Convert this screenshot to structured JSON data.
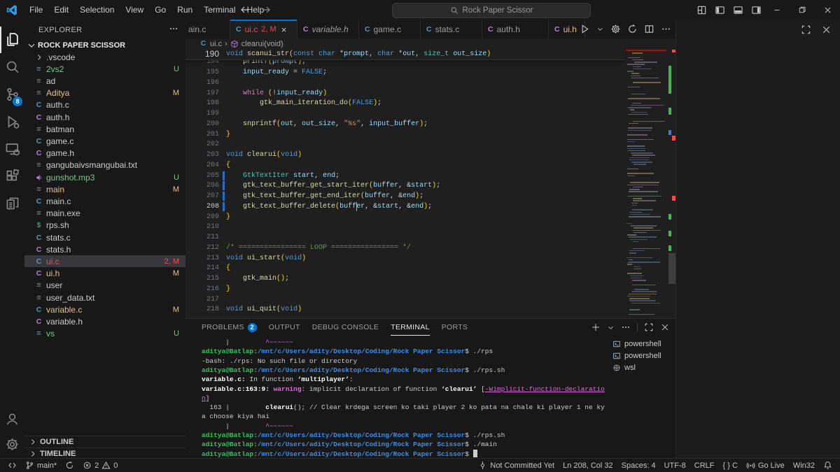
{
  "window": {
    "menus": [
      "File",
      "Edit",
      "Selection",
      "View",
      "Go",
      "Run",
      "Terminal",
      "Help"
    ],
    "search": "Rock Paper Scissor",
    "nav": [
      "back",
      "forward"
    ],
    "layout_controls": [
      "customize-layout",
      "toggle-sidebar-left",
      "toggle-panel-bottom",
      "toggle-sidebar-right"
    ],
    "controls": [
      "minimize",
      "restore",
      "close"
    ]
  },
  "activity_bar": {
    "top": [
      {
        "id": "explorer",
        "active": true
      },
      {
        "id": "search"
      },
      {
        "id": "source-control",
        "badge": "8"
      },
      {
        "id": "run-debug"
      },
      {
        "id": "remote-explorer"
      },
      {
        "id": "extensions"
      },
      {
        "id": "references"
      }
    ],
    "bottom": [
      {
        "id": "account"
      },
      {
        "id": "settings"
      }
    ]
  },
  "explorer": {
    "title": "EXPLORER",
    "root": "ROCK PAPER SCISSOR",
    "files": [
      {
        "name": ".vscode",
        "icon": "folder"
      },
      {
        "name": "2vs2",
        "icon": "file",
        "badge": "U",
        "state": "untracked"
      },
      {
        "name": "ad",
        "icon": "file"
      },
      {
        "name": "Aditya",
        "icon": "file",
        "badge": "M",
        "state": "modified"
      },
      {
        "name": "auth.c",
        "icon": "c-blue"
      },
      {
        "name": "auth.h",
        "icon": "c-purple"
      },
      {
        "name": "batman",
        "icon": "file"
      },
      {
        "name": "game.c",
        "icon": "c-blue"
      },
      {
        "name": "game.h",
        "icon": "c-purple"
      },
      {
        "name": "gangubaivsmangubai.txt",
        "icon": "file"
      },
      {
        "name": "gunshot.mp3",
        "icon": "audio",
        "badge": "U",
        "state": "untracked"
      },
      {
        "name": "main",
        "icon": "file",
        "badge": "M",
        "state": "modified"
      },
      {
        "name": "main.c",
        "icon": "c-blue"
      },
      {
        "name": "main.exe",
        "icon": "file"
      },
      {
        "name": "rps.sh",
        "icon": "shell"
      },
      {
        "name": "stats.c",
        "icon": "c-blue"
      },
      {
        "name": "stats.h",
        "icon": "c-purple"
      },
      {
        "name": "ui.c",
        "icon": "c-blue",
        "badge": "2, M",
        "state": "error",
        "selected": true
      },
      {
        "name": "ui.h",
        "icon": "c-purple",
        "badge": "M",
        "state": "modified"
      },
      {
        "name": "user",
        "icon": "file"
      },
      {
        "name": "user_data.txt",
        "icon": "file"
      },
      {
        "name": "variable.c",
        "icon": "c-blue",
        "badge": "M",
        "state": "modified"
      },
      {
        "name": "variable.h",
        "icon": "c-purple"
      },
      {
        "name": "vs",
        "icon": "file",
        "badge": "U",
        "state": "untracked"
      }
    ],
    "sections": [
      "OUTLINE",
      "TIMELINE"
    ]
  },
  "editor_tabs": {
    "partial_tab": "ain.c",
    "tabs": [
      {
        "label": "ui.c",
        "icon": "c-blue",
        "badge": "2, M",
        "state": "error",
        "active": true,
        "close": true
      },
      {
        "label": "variable.h",
        "icon": "c-purple",
        "preview": true
      },
      {
        "label": "game.c",
        "icon": "c-blue"
      },
      {
        "label": "stats.c",
        "icon": "c-blue"
      },
      {
        "label": "auth.h",
        "icon": "c-purple"
      },
      {
        "label": "ui.h",
        "icon": "c-purple",
        "state": "modified"
      }
    ],
    "actions": [
      "run",
      "chevron-down",
      "gear",
      "sync",
      "split-editor",
      "more"
    ]
  },
  "breadcrumb": {
    "file": "ui.c",
    "separator": "›",
    "symbol": "clearui(void)"
  },
  "editor": {
    "sticky_line": {
      "n": 190,
      "toks": [
        [
          "void",
          "k"
        ],
        [
          " ",
          "p"
        ],
        [
          "scanui_str",
          "f"
        ],
        [
          "(",
          "g"
        ],
        [
          "const",
          "k"
        ],
        [
          " ",
          "p"
        ],
        [
          "char",
          "k"
        ],
        [
          " *",
          "p"
        ],
        [
          "prompt",
          "v"
        ],
        [
          ", ",
          "p"
        ],
        [
          "char",
          "k"
        ],
        [
          " *",
          "p"
        ],
        [
          "out",
          "v"
        ],
        [
          ", ",
          "p"
        ],
        [
          "size_t",
          "t"
        ],
        [
          " ",
          "p"
        ],
        [
          "out_size",
          "v"
        ],
        [
          ")",
          "g"
        ]
      ]
    },
    "lines": [
      {
        "n": 194,
        "toks": [
          [
            "    ",
            "p"
          ],
          [
            "printf",
            "f"
          ],
          [
            "(",
            "g"
          ],
          [
            "prompt",
            "v"
          ],
          [
            ")",
            "g"
          ],
          [
            ";",
            "p"
          ]
        ]
      },
      {
        "n": 195,
        "toks": [
          [
            "    ",
            "p"
          ],
          [
            "input_ready",
            "v"
          ],
          [
            " = ",
            "p"
          ],
          [
            "FALSE",
            "k"
          ],
          [
            ";",
            "p"
          ]
        ]
      },
      {
        "n": 196,
        "toks": []
      },
      {
        "n": 197,
        "toks": [
          [
            "    ",
            "p"
          ],
          [
            "while",
            "c"
          ],
          [
            " ",
            "p"
          ],
          [
            "(",
            "g"
          ],
          [
            "!",
            "p"
          ],
          [
            "input_ready",
            "v"
          ],
          [
            ")",
            "g"
          ]
        ]
      },
      {
        "n": 198,
        "toks": [
          [
            "        ",
            "p"
          ],
          [
            "gtk_main_iteration_do",
            "f"
          ],
          [
            "(",
            "g"
          ],
          [
            "FALSE",
            "k"
          ],
          [
            ")",
            "g"
          ],
          [
            ";",
            "p"
          ]
        ]
      },
      {
        "n": 199,
        "toks": []
      },
      {
        "n": 200,
        "toks": [
          [
            "    ",
            "p"
          ],
          [
            "snprintf",
            "f"
          ],
          [
            "(",
            "g"
          ],
          [
            "out",
            "v"
          ],
          [
            ", ",
            "p"
          ],
          [
            "out_size",
            "v"
          ],
          [
            ", ",
            "p"
          ],
          [
            "\"%s\"",
            "s"
          ],
          [
            ", ",
            "p"
          ],
          [
            "input_buffer",
            "v"
          ],
          [
            ")",
            "g"
          ],
          [
            ";",
            "p"
          ]
        ]
      },
      {
        "n": 201,
        "toks": [
          [
            "}",
            "g"
          ]
        ]
      },
      {
        "n": 202,
        "toks": []
      },
      {
        "n": 203,
        "toks": [
          [
            "void",
            "k"
          ],
          [
            " ",
            "p"
          ],
          [
            "clearui",
            "f"
          ],
          [
            "(",
            "g"
          ],
          [
            "void",
            "k"
          ],
          [
            ")",
            "g"
          ]
        ]
      },
      {
        "n": 204,
        "toks": [
          [
            "{",
            "g"
          ]
        ]
      },
      {
        "n": 205,
        "mod": true,
        "toks": [
          [
            "    ",
            "p"
          ],
          [
            "GtkTextIter",
            "t"
          ],
          [
            " ",
            "p"
          ],
          [
            "start",
            "v"
          ],
          [
            ", ",
            "p"
          ],
          [
            "end",
            "v"
          ],
          [
            ";",
            "p"
          ]
        ]
      },
      {
        "n": 206,
        "mod": true,
        "toks": [
          [
            "    ",
            "p"
          ],
          [
            "gtk_text_buffer_get_start_iter",
            "f"
          ],
          [
            "(",
            "g"
          ],
          [
            "buffer",
            "v"
          ],
          [
            ", &",
            "p"
          ],
          [
            "start",
            "v"
          ],
          [
            ")",
            "g"
          ],
          [
            ";",
            "p"
          ]
        ]
      },
      {
        "n": 207,
        "mod": true,
        "toks": [
          [
            "    ",
            "p"
          ],
          [
            "gtk_text_buffer_get_end_iter",
            "f"
          ],
          [
            "(",
            "g"
          ],
          [
            "buffer",
            "v"
          ],
          [
            ", &",
            "p"
          ],
          [
            "end",
            "v"
          ],
          [
            ")",
            "g"
          ],
          [
            ";",
            "p"
          ]
        ]
      },
      {
        "n": 208,
        "mod": true,
        "cur": true,
        "toks": [
          [
            "    ",
            "p"
          ],
          [
            "gtk_text_buffer_delete",
            "f"
          ],
          [
            "(",
            "g"
          ],
          [
            "buffer",
            "v"
          ],
          [
            ", &",
            "p"
          ],
          [
            "start",
            "v"
          ],
          [
            ", &",
            "p"
          ],
          [
            "end",
            "v"
          ],
          [
            ")",
            "g"
          ],
          [
            ";",
            "p"
          ]
        ]
      },
      {
        "n": 209,
        "toks": [
          [
            "}",
            "g"
          ]
        ]
      },
      {
        "n": 210,
        "toks": []
      },
      {
        "n": 211,
        "toks": []
      },
      {
        "n": 212,
        "toks": [
          [
            "/* ================ LOOP ================ */",
            "m"
          ]
        ]
      },
      {
        "n": 213,
        "toks": [
          [
            "void",
            "k"
          ],
          [
            " ",
            "p"
          ],
          [
            "ui_start",
            "f"
          ],
          [
            "(",
            "g"
          ],
          [
            "void",
            "k"
          ],
          [
            ")",
            "g"
          ]
        ]
      },
      {
        "n": 214,
        "toks": [
          [
            "{",
            "g"
          ]
        ]
      },
      {
        "n": 215,
        "toks": [
          [
            "    ",
            "p"
          ],
          [
            "gtk_main",
            "f"
          ],
          [
            "(",
            "g"
          ],
          [
            ")",
            "g"
          ],
          [
            ";",
            "p"
          ]
        ]
      },
      {
        "n": 216,
        "toks": [
          [
            "}",
            "g"
          ]
        ]
      },
      {
        "n": 217,
        "toks": []
      },
      {
        "n": 218,
        "toks": [
          [
            "void",
            "k"
          ],
          [
            " ",
            "p"
          ],
          [
            "ui_quit",
            "f"
          ],
          [
            "(",
            "g"
          ],
          [
            "void",
            "k"
          ],
          [
            ")",
            "g"
          ]
        ]
      }
    ],
    "cursor": {
      "line": 208,
      "col": 32
    }
  },
  "panel": {
    "tabs": [
      {
        "label": "PROBLEMS",
        "badge": "2"
      },
      {
        "label": "OUTPUT"
      },
      {
        "label": "DEBUG CONSOLE"
      },
      {
        "label": "TERMINAL",
        "active": true
      },
      {
        "label": "PORTS"
      }
    ],
    "actions": [
      "plus",
      "chevron-down",
      "more",
      "divider",
      "screen-full",
      "close"
    ],
    "terminal": {
      "user": "aditya@Batlap",
      "cwd": "/mnt/c/Users/adity/Desktop/Coding/Rock Paper Scissor",
      "lines": [
        {
          "segs": [
            [
              "      |         ",
              "w"
            ],
            [
              "^~~~~~~",
              "m"
            ]
          ]
        },
        {
          "prompt": "./rps"
        },
        {
          "segs": [
            [
              "-bash: ./rps: No such file or directory",
              "w"
            ]
          ]
        },
        {
          "prompt": "./rps.sh"
        },
        {
          "segs": [
            [
              "variable.c:",
              "wb"
            ],
            [
              " In function ",
              "w"
            ],
            [
              "‘multiplayer’",
              "wb"
            ],
            [
              ":",
              "w"
            ]
          ]
        },
        {
          "segs": [
            [
              "variable.c:163:9:",
              "wb"
            ],
            [
              " ",
              "w"
            ],
            [
              "warning:",
              "mb"
            ],
            [
              " implicit declaration of function ",
              "w"
            ],
            [
              "‘clearui’",
              "wb"
            ],
            [
              " [",
              "w"
            ],
            [
              "-Wimplicit-function-declaratio",
              "mu"
            ]
          ]
        },
        {
          "segs": [
            [
              "n",
              "mu"
            ],
            [
              "]",
              "w"
            ]
          ]
        },
        {
          "segs": [
            [
              "  163 |         ",
              "w"
            ],
            [
              "clearui",
              "wb"
            ],
            [
              "(); // Clear krdega screen ko taki player 2 ko pata na chale ki player 1 ne ky",
              "w"
            ]
          ]
        },
        {
          "segs": [
            [
              "a choose kiya hai",
              "w"
            ]
          ]
        },
        {
          "segs": [
            [
              "      |         ",
              "w"
            ],
            [
              "^~~~~~~",
              "m"
            ]
          ]
        },
        {
          "prompt": "./rps.sh"
        },
        {
          "prompt": "./main"
        },
        {
          "prompt": "",
          "cursor": true
        }
      ]
    },
    "terminal_list": [
      {
        "icon": "powershell",
        "label": "powershell"
      },
      {
        "icon": "powershell",
        "label": "powershell"
      },
      {
        "icon": "wsl",
        "label": "wsl"
      }
    ]
  },
  "empty_group": {
    "actions": [
      "screen-full",
      "close"
    ]
  },
  "statusbar": {
    "left": [
      {
        "icon": "remote",
        "name": "remote-indicator"
      },
      {
        "icon": "branch",
        "label": "main*",
        "name": "git-branch"
      },
      {
        "icon": "sync",
        "name": "git-sync"
      },
      {
        "icon": "error",
        "label": "2",
        "icon2": "warning",
        "label2": "0",
        "name": "problems"
      }
    ],
    "right": [
      {
        "icon": "commit",
        "label": "Not Committed Yet",
        "name": "git-commit-status"
      },
      {
        "label": "Ln 208, Col 32",
        "name": "cursor-position"
      },
      {
        "label": "Spaces: 4",
        "name": "indentation"
      },
      {
        "label": "UTF-8",
        "name": "encoding"
      },
      {
        "label": "CRLF",
        "name": "eol"
      },
      {
        "label": "{ } C",
        "name": "language-mode"
      },
      {
        "icon": "broadcast",
        "label": "Go Live",
        "name": "go-live"
      },
      {
        "label": "Win32",
        "name": "platform"
      },
      {
        "icon": "bell",
        "label": "",
        "name": "notifications"
      }
    ]
  },
  "colors": {
    "accent": "#0078d4",
    "error": "#f14c4c",
    "modified": "#e2c08d",
    "untracked": "#73c991",
    "c_file": "#519aba",
    "h_file": "#b180d7",
    "terminal_green": "#2dc55e",
    "terminal_blue": "#3b8eea",
    "terminal_magenta": "#d670d6"
  }
}
